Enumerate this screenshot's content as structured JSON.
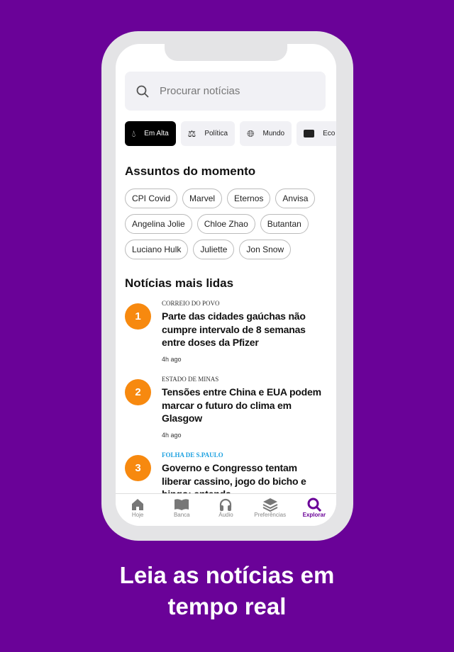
{
  "search": {
    "placeholder": "Procurar notícias",
    "icon": "search-icon"
  },
  "categories": [
    {
      "label": "Em Alta",
      "icon": "flame-icon",
      "active": true
    },
    {
      "label": "Política",
      "icon": "scale-icon"
    },
    {
      "label": "Mundo",
      "icon": "globe-icon"
    },
    {
      "label": "Eco",
      "icon": "money-icon"
    }
  ],
  "trending": {
    "title": "Assuntos do momento",
    "tags": [
      "CPI Covid",
      "Marvel",
      "Eternos",
      "Anvisa",
      "Angelina Jolie",
      "Chloe Zhao",
      "Butantan",
      "Luciano Hulk",
      "Juliette",
      "Jon Snow"
    ]
  },
  "most_read": {
    "title": "Notícias mais lidas",
    "items": [
      {
        "rank": "1",
        "source": "CORREIO DO POVO",
        "title": "Parte das cidades gaúchas não cumpre intervalo de 8 semanas entre doses da Pfizer",
        "time": "4h ago"
      },
      {
        "rank": "2",
        "source": "ESTADO DE MINAS",
        "title": "Tensões entre China e EUA podem marcar o futuro do clima em Glasgow",
        "time": "4h ago"
      },
      {
        "rank": "3",
        "source": "FOLHA DE S.PAULO",
        "title": "Governo e Congresso tentam liberar cassino, jogo do bicho e bingo; entenda",
        "source_color": "#1da1e0"
      }
    ]
  },
  "tabs": [
    {
      "label": "Hoje",
      "icon": "home-icon"
    },
    {
      "label": "Banca",
      "icon": "book-icon"
    },
    {
      "label": "Áudio",
      "icon": "headphones-icon"
    },
    {
      "label": "Preferências",
      "icon": "layers-icon"
    },
    {
      "label": "Explorar",
      "icon": "search-icon",
      "active": true
    }
  ],
  "caption": {
    "line1": "Leia as notícias em",
    "line2": "tempo real"
  },
  "colors": {
    "background": "#6a0298",
    "accent": "#6a0298",
    "rank": "#f7890f"
  }
}
